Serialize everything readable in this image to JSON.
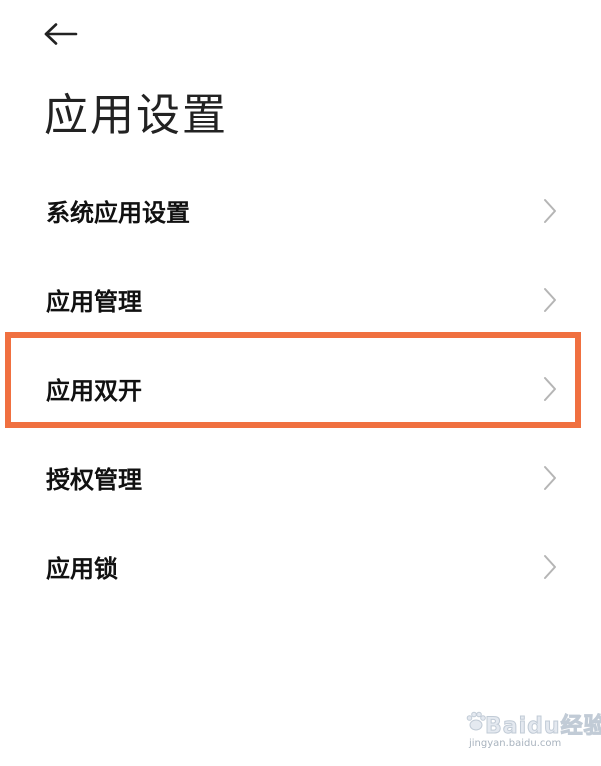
{
  "header": {
    "back_icon": "back-arrow-icon",
    "title": "应用设置"
  },
  "settings": {
    "items": [
      {
        "label": "系统应用设置",
        "icon": "chevron-right-icon"
      },
      {
        "label": "应用管理",
        "icon": "chevron-right-icon"
      },
      {
        "label": "应用双开",
        "icon": "chevron-right-icon",
        "highlighted": true
      },
      {
        "label": "授权管理",
        "icon": "chevron-right-icon"
      },
      {
        "label": "应用锁",
        "icon": "chevron-right-icon"
      }
    ]
  },
  "annotation": {
    "highlight_color": "#f07040"
  },
  "watermark": {
    "brand": "Baidu经验",
    "url": "jingyan.baidu.com"
  },
  "colors": {
    "background": "#ffffff",
    "text": "#111111",
    "chevron": "#b5b5b5"
  }
}
